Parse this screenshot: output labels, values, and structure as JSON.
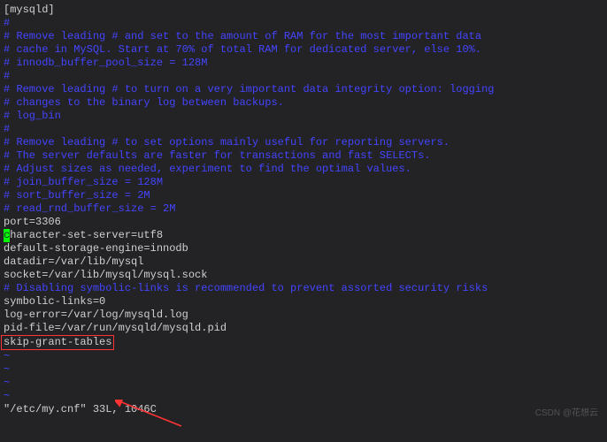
{
  "lines": [
    {
      "cls": "section-open",
      "text": "[mysqld]"
    },
    {
      "cls": "comment",
      "text": "#"
    },
    {
      "cls": "comment",
      "text": "# Remove leading # and set to the amount of RAM for the most important data"
    },
    {
      "cls": "comment",
      "text": "# cache in MySQL. Start at 70% of total RAM for dedicated server, else 10%."
    },
    {
      "cls": "comment",
      "text": "# innodb_buffer_pool_size = 128M"
    },
    {
      "cls": "comment",
      "text": "#"
    },
    {
      "cls": "comment",
      "text": "# Remove leading # to turn on a very important data integrity option: logging"
    },
    {
      "cls": "comment",
      "text": "# changes to the binary log between backups."
    },
    {
      "cls": "comment",
      "text": "# log_bin"
    },
    {
      "cls": "comment",
      "text": "#"
    },
    {
      "cls": "comment",
      "text": "# Remove leading # to set options mainly useful for reporting servers."
    },
    {
      "cls": "comment",
      "text": "# The server defaults are faster for transactions and fast SELECTs."
    },
    {
      "cls": "comment",
      "text": "# Adjust sizes as needed, experiment to find the optimal values."
    },
    {
      "cls": "comment",
      "text": "# join_buffer_size = 128M"
    },
    {
      "cls": "comment",
      "text": "# sort_buffer_size = 2M"
    },
    {
      "cls": "comment",
      "text": "# read_rnd_buffer_size = 2M"
    },
    {
      "cls": "normal",
      "text": ""
    },
    {
      "cls": "normal",
      "text": "port=3306"
    },
    {
      "cls": "normal",
      "text": "character-set-server=utf8",
      "cursor": true
    },
    {
      "cls": "normal",
      "text": "default-storage-engine=innodb"
    },
    {
      "cls": "normal",
      "text": ""
    },
    {
      "cls": "normal",
      "text": "datadir=/var/lib/mysql"
    },
    {
      "cls": "normal",
      "text": "socket=/var/lib/mysql/mysql.sock"
    },
    {
      "cls": "normal",
      "text": ""
    },
    {
      "cls": "comment",
      "text": "# Disabling symbolic-links is recommended to prevent assorted security risks"
    },
    {
      "cls": "normal",
      "text": "symbolic-links=0"
    },
    {
      "cls": "normal",
      "text": ""
    },
    {
      "cls": "normal",
      "text": "log-error=/var/log/mysqld.log"
    },
    {
      "cls": "normal",
      "text": "pid-file=/var/run/mysqld/mysqld.pid"
    },
    {
      "cls": "normal",
      "text": "skip-grant-tables",
      "highlight": true
    },
    {
      "cls": "tilde",
      "text": "~"
    },
    {
      "cls": "tilde",
      "text": "~"
    },
    {
      "cls": "tilde",
      "text": "~"
    },
    {
      "cls": "tilde",
      "text": "~"
    }
  ],
  "status": "\"/etc/my.cnf\" 33L, 1046C",
  "watermark": "CSDN @花想云"
}
